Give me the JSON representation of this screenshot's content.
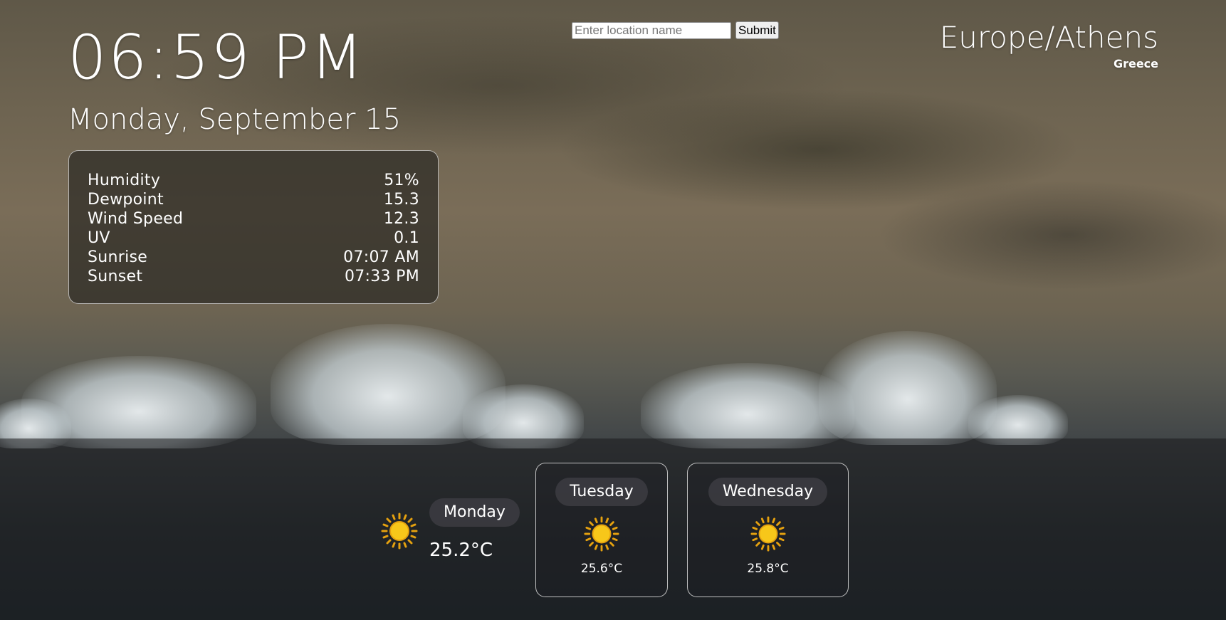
{
  "clock": {
    "time": "06:59 PM",
    "date": "Monday, September 15"
  },
  "details": [
    {
      "label": "Humidity",
      "value": "51%"
    },
    {
      "label": "Dewpoint",
      "value": "15.3"
    },
    {
      "label": "Wind Speed",
      "value": "12.3"
    },
    {
      "label": "UV",
      "value": "0.1"
    },
    {
      "label": "Sunrise",
      "value": "07:07 AM"
    },
    {
      "label": "Sunset",
      "value": "07:33 PM"
    }
  ],
  "search": {
    "placeholder": "Enter location name",
    "value": "",
    "submit_label": "Submit"
  },
  "location": {
    "timezone": "Europe/Athens",
    "country": "Greece"
  },
  "forecast": {
    "today": {
      "day": "Monday",
      "temp": "25.2°C",
      "icon": "sun-icon"
    },
    "days": [
      {
        "day": "Tuesday",
        "temp": "25.6°C",
        "icon": "sun-icon"
      },
      {
        "day": "Wednesday",
        "temp": "25.8°C",
        "icon": "sun-icon"
      }
    ]
  },
  "colors": {
    "sun": "#f7c71a",
    "sun_ray": "#e5a10f",
    "panel_border": "#ebebeb"
  }
}
